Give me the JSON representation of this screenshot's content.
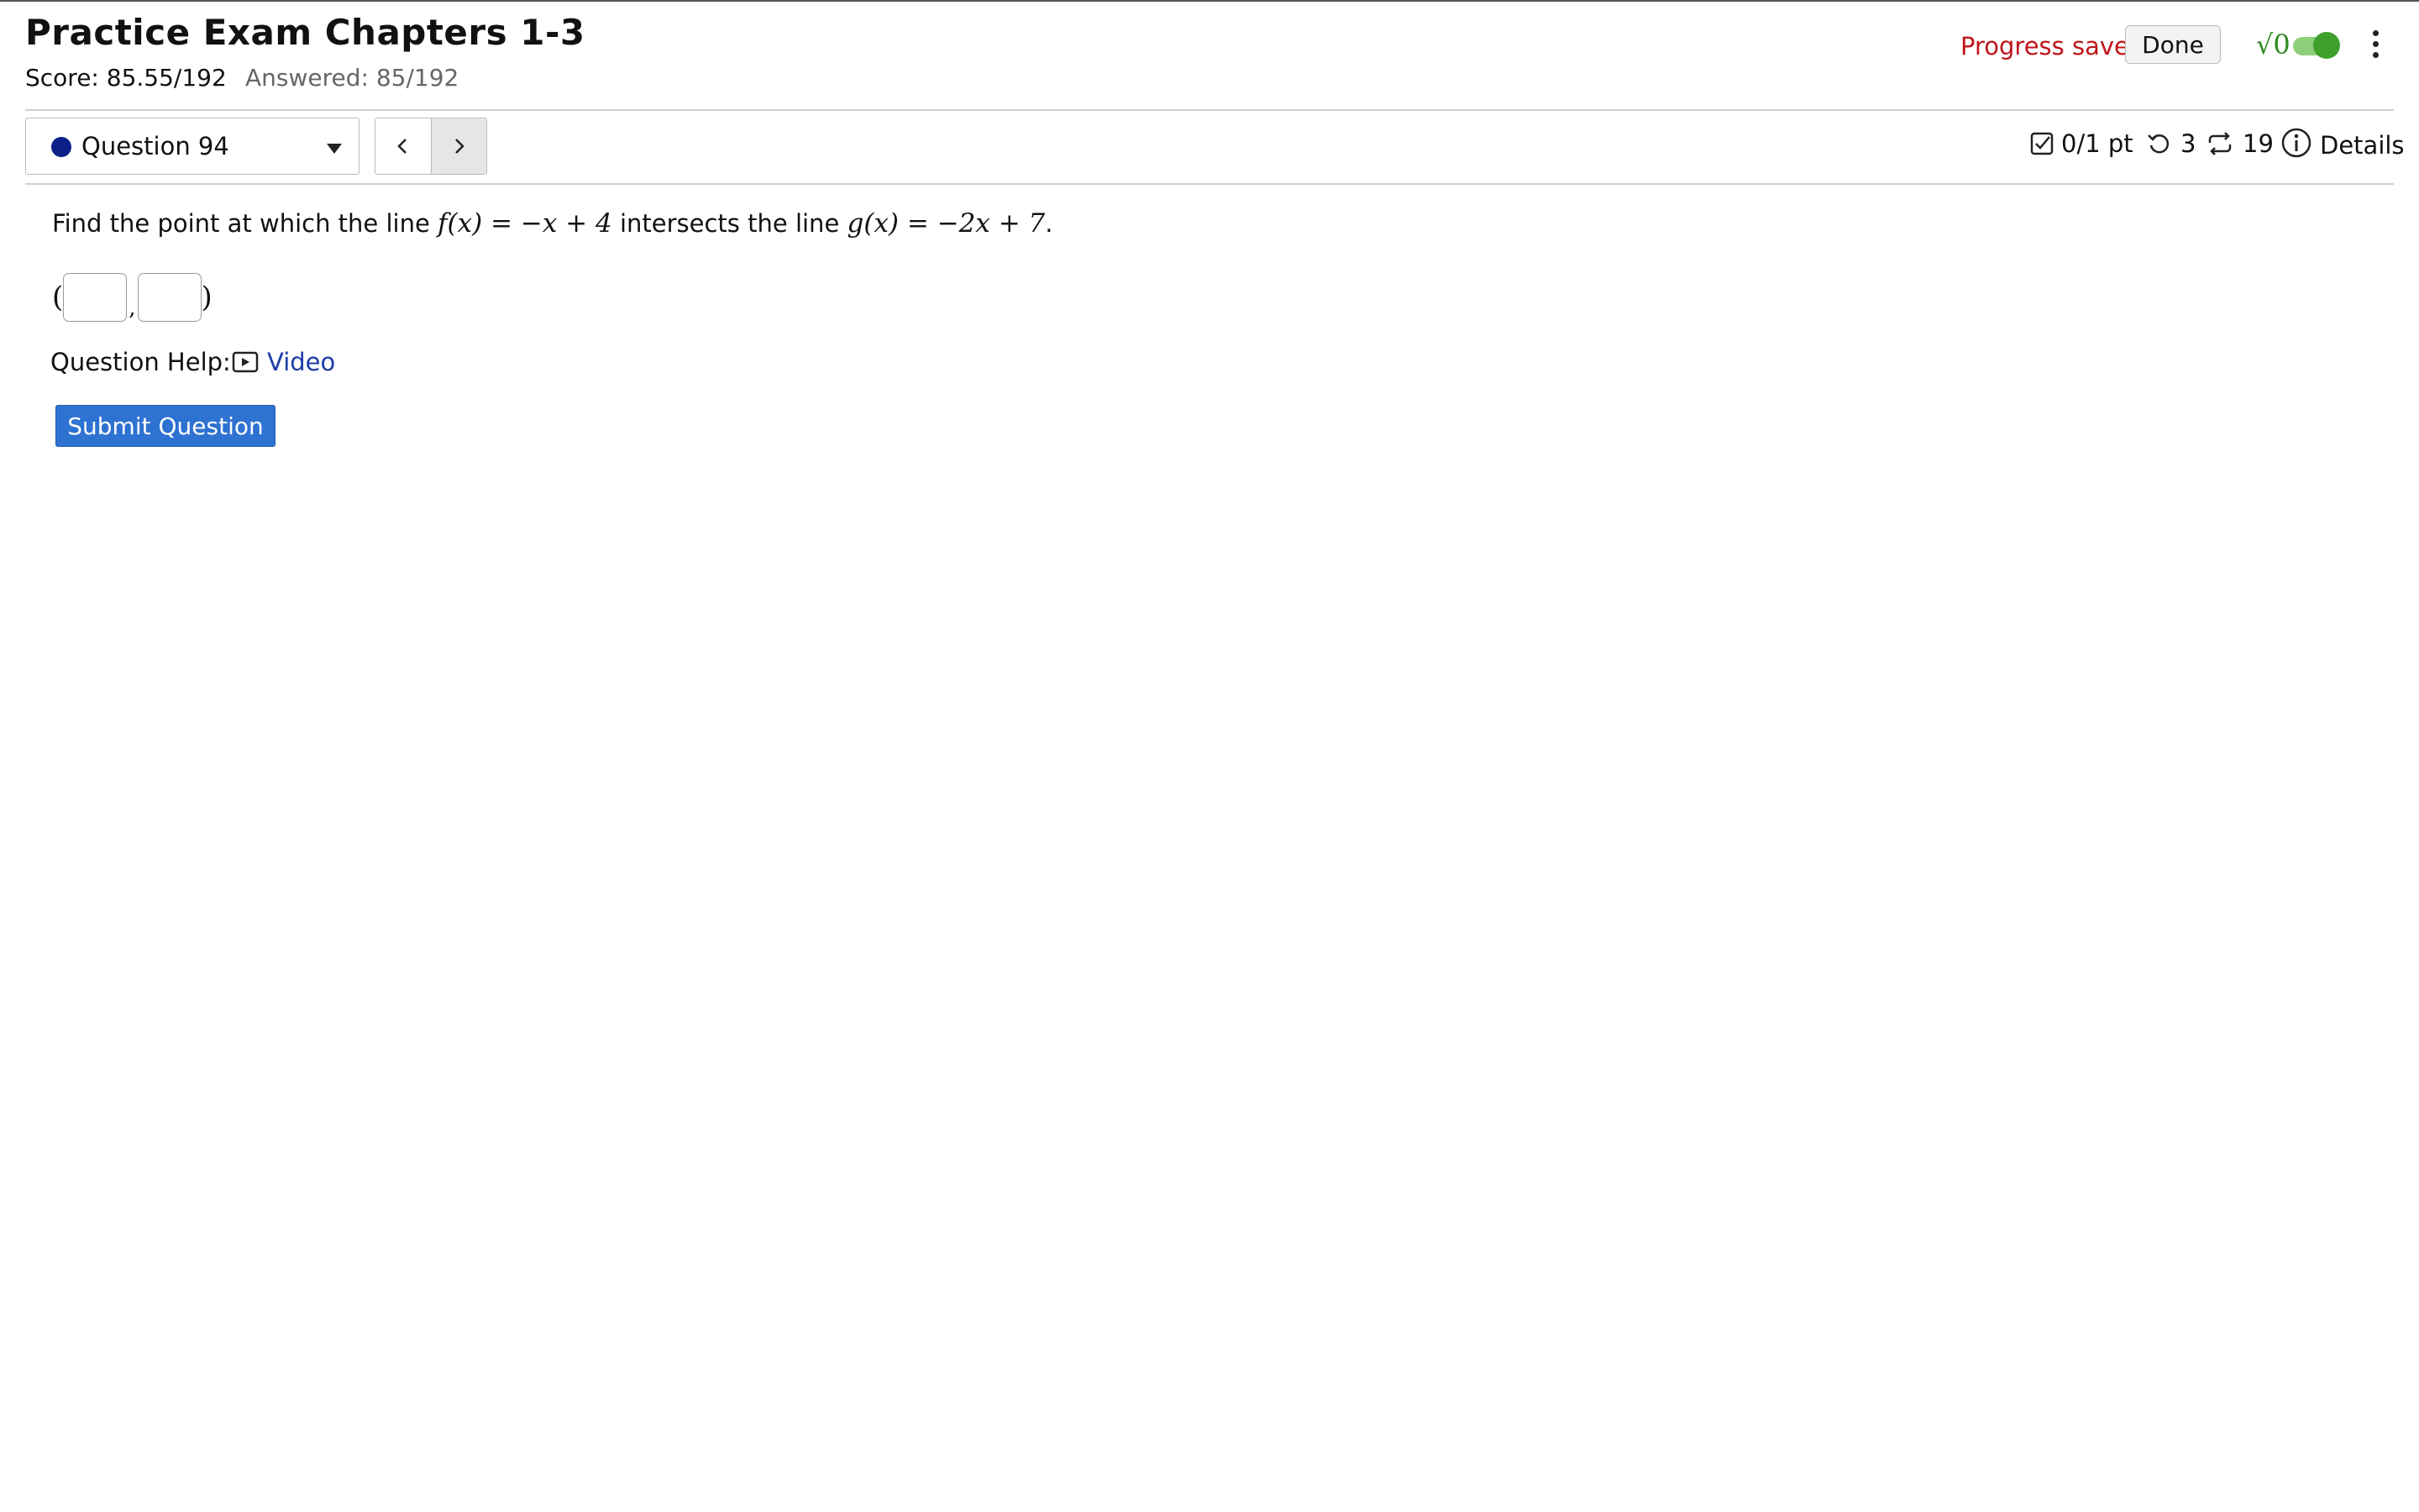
{
  "header": {
    "title": "Practice Exam Chapters 1-3",
    "score": "Score: 85.55/192",
    "answered": "Answered: 85/192",
    "progress_status": "Progress saved",
    "done_label": "Done",
    "math_toggle_icon": "square-root-icon",
    "math_toggle_on": true
  },
  "navigation": {
    "question_select": "Question 94",
    "prev_icon": "chevron-left-icon",
    "next_icon": "chevron-right-icon"
  },
  "question_meta": {
    "points": "0/1 pt",
    "attempts": "3",
    "versions": "19",
    "details_label": "Details"
  },
  "question": {
    "text_before": "Find the point at which the line",
    "f_expr": "f(x) = −x + 4",
    "text_middle": "intersects the line",
    "g_expr": "g(x) = −2x + 7",
    "text_end": ".",
    "answer_x": "",
    "answer_y": ""
  },
  "help": {
    "label": "Question Help:",
    "video_label": "Video"
  },
  "actions": {
    "submit_label": "Submit Question"
  },
  "colors": {
    "progress_saved": "#c0161c",
    "toggle_on": "#3fa02c",
    "link": "#1d3ca8",
    "submit_bg": "#2e72d2",
    "question_dot": "#0a1f87"
  }
}
